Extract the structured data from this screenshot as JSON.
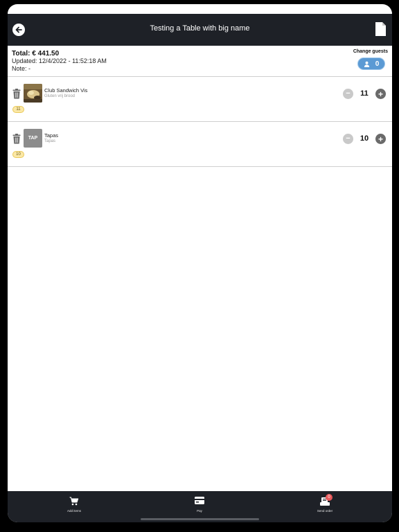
{
  "header": {
    "title": "Testing a Table with big name"
  },
  "summary": {
    "total": "Total: € 441.50",
    "updated": "Updated: 12/4/2022 - 11:52:18 AM",
    "note": "Note:  -",
    "guests_label": "Change guests",
    "guests_count": "0"
  },
  "items": [
    {
      "name": "Club Sandwich Vis",
      "subtitle": "Gluten vrij brood",
      "quantity": "11",
      "badge": "11",
      "thumb": "photo"
    },
    {
      "name": "Tapas",
      "subtitle": "Tapas",
      "quantity": "10",
      "badge": "10",
      "thumb_text": "TAP"
    }
  ],
  "tabs": [
    {
      "label": "Add items",
      "icon": "cart-icon"
    },
    {
      "label": "Pay",
      "icon": "card-icon"
    },
    {
      "label": "Send order",
      "icon": "send-order-icon",
      "badge": "0"
    }
  ],
  "colors": {
    "bar": "#1e2127",
    "accent": "#5b9ad4",
    "badge_bg": "#fbe8a6",
    "notif": "#e8585a"
  }
}
